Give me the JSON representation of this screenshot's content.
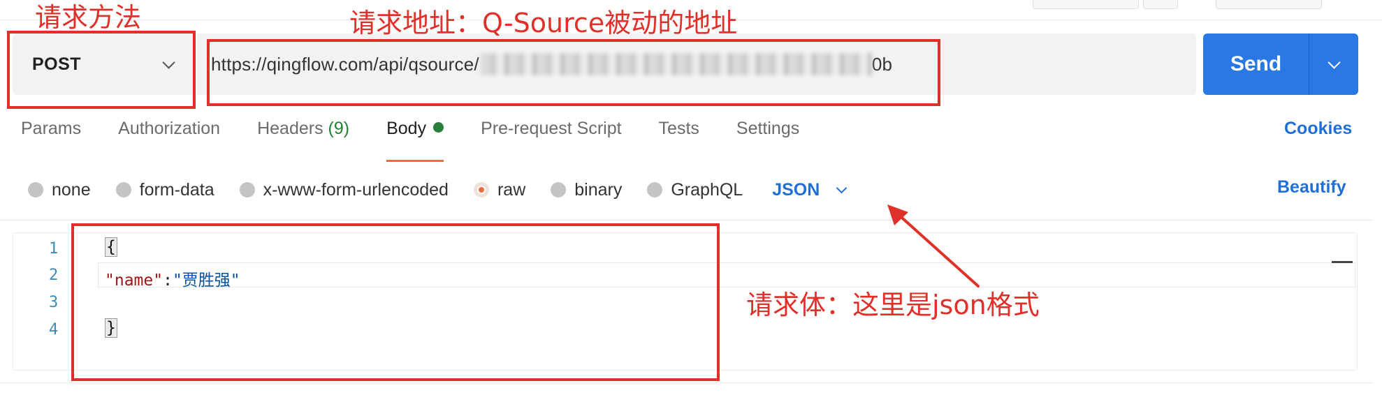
{
  "request": {
    "method": "POST",
    "url_visible_prefix": "https://qingflow.com/api/qsource/",
    "url_visible_suffix": "0b",
    "send_label": "Send"
  },
  "tabs": [
    {
      "label": "Params"
    },
    {
      "label": "Authorization"
    },
    {
      "label": "Headers",
      "count": "(9)"
    },
    {
      "label": "Body",
      "active": true
    },
    {
      "label": "Pre-request Script"
    },
    {
      "label": "Tests"
    },
    {
      "label": "Settings"
    }
  ],
  "cookies_label": "Cookies",
  "body_types": [
    {
      "label": "none"
    },
    {
      "label": "form-data"
    },
    {
      "label": "x-www-form-urlencoded"
    },
    {
      "label": "raw",
      "selected": true
    },
    {
      "label": "binary"
    },
    {
      "label": "GraphQL"
    }
  ],
  "format_label": "JSON",
  "beautify_label": "Beautify",
  "editor": {
    "line_numbers": [
      "1",
      "2",
      "3",
      "4"
    ],
    "open_brace": "{",
    "key": "\"name\"",
    "colon": ":",
    "value": "\"贾胜强\"",
    "close_brace": "}"
  },
  "annotations": {
    "method_note": "请求方法",
    "url_note": "请求地址：Q-Source被动的地址",
    "body_note": "请求体：这里是json格式"
  },
  "colors": {
    "accent_blue": "#2a78e4",
    "active_tab_underline": "#f26b3a",
    "annotation_red": "#e0302a",
    "body_dot_green": "#26803a"
  },
  "icons": {
    "method_dropdown": "chevron-down-icon",
    "send_dropdown": "chevron-down-icon",
    "format_dropdown": "chevron-down-icon",
    "annotation_arrow": "arrow-up-left-icon"
  }
}
